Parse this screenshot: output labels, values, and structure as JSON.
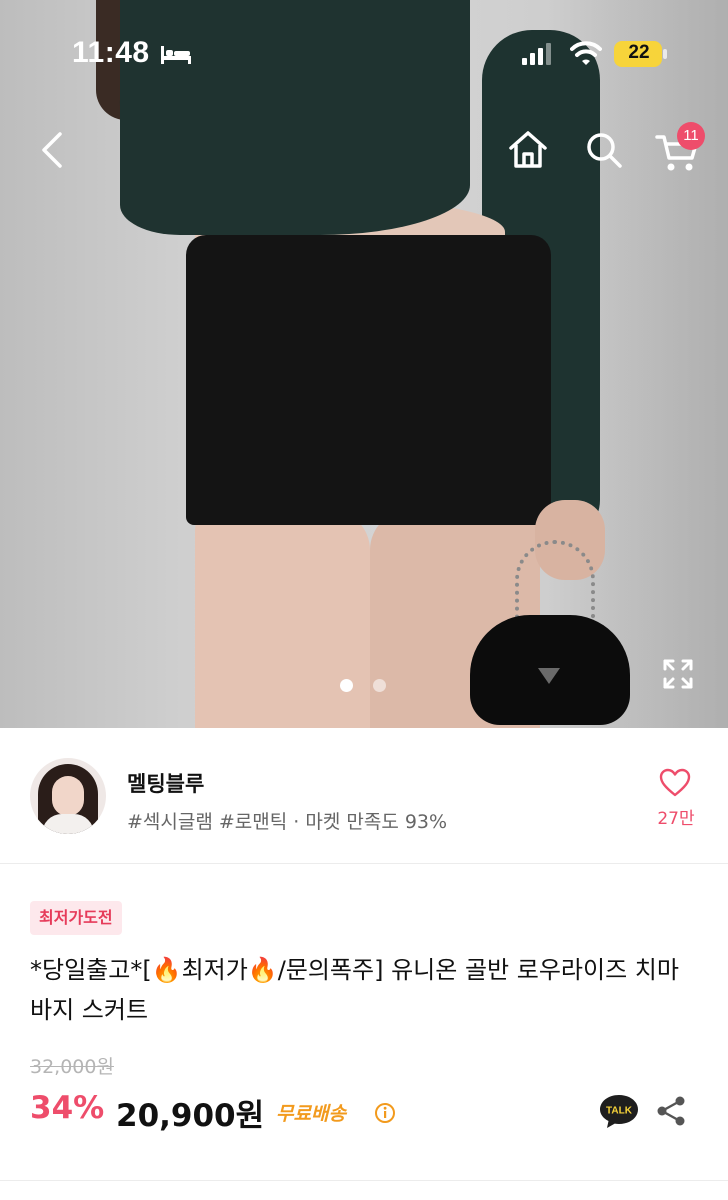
{
  "status_bar": {
    "time": "11:48",
    "battery": "22",
    "icons": [
      "bed-icon",
      "signal-icon",
      "wifi-icon",
      "battery-icon"
    ]
  },
  "nav": {
    "icons": [
      "back-icon",
      "home-icon",
      "search-icon",
      "cart-icon"
    ],
    "cart_count": "11"
  },
  "gallery": {
    "current_slide": 1,
    "total_slides": 2,
    "expand_icon": "expand-icon"
  },
  "shop": {
    "name": "멜팅블루",
    "tags": "#섹시글램 #로맨틱 · 마켓 만족도 93%",
    "likes": "27만",
    "heart_icon": "heart-icon"
  },
  "product": {
    "badge": "최저가도전",
    "title": "*당일출고*[🔥최저가🔥/문의폭주] 유니온 골반 로우라이즈 치마바지 스커트",
    "original_price": "32,000원",
    "discount": "34%",
    "price": "20,900원",
    "shipping": "무료배송"
  },
  "actions": {
    "talk_label": "TALK",
    "icons": [
      "info-icon",
      "talk-icon",
      "share-icon"
    ]
  },
  "colors": {
    "accent": "#ee4d6b",
    "shipping": "#f29a1d",
    "battery": "#f7d43a",
    "talk": "#1e1e1e"
  }
}
